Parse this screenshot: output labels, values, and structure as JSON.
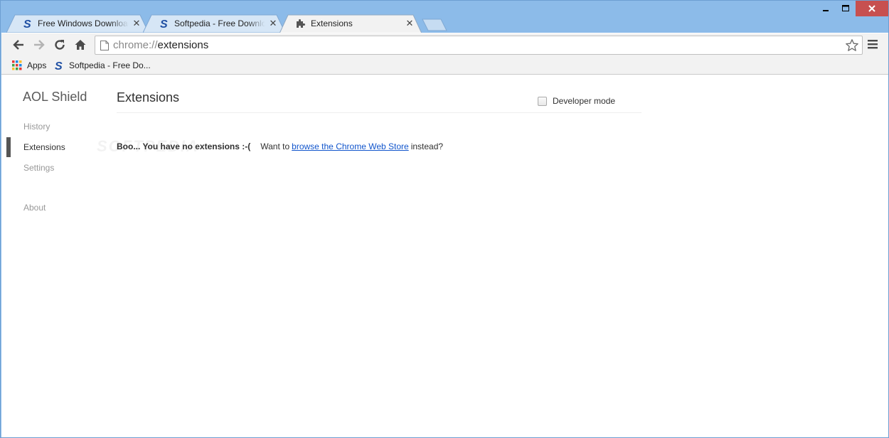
{
  "window": {
    "controls": {
      "minimize": "–",
      "maximize": "□",
      "close": "✕"
    }
  },
  "tabs": [
    {
      "title": "Free Windows Downloads",
      "favicon": "softpedia-s-icon",
      "active": false
    },
    {
      "title": "Softpedia - Free Downloads",
      "favicon": "softpedia-s-icon",
      "active": false
    },
    {
      "title": "Extensions",
      "favicon": "puzzle-piece-icon",
      "active": true
    }
  ],
  "toolbar": {
    "url_scheme": "chrome://",
    "url_path": "extensions"
  },
  "bookmarks": [
    {
      "label": "Apps",
      "icon": "apps-grid-icon"
    },
    {
      "label": "Softpedia - Free Do...",
      "icon": "softpedia-s-icon"
    }
  ],
  "sidebar": {
    "brand": "AOL Shield",
    "items": [
      {
        "label": "History",
        "active": false
      },
      {
        "label": "Extensions",
        "active": true
      },
      {
        "label": "Settings",
        "active": false
      },
      {
        "label": "About",
        "active": false
      }
    ]
  },
  "main": {
    "title": "Extensions",
    "developer_mode_label": "Developer mode",
    "developer_mode_checked": false,
    "empty_bold": "Boo... You have no extensions :-(",
    "empty_prefix": "Want to",
    "empty_link": "browse the Chrome Web Store",
    "empty_suffix": "instead?"
  },
  "watermark": "SOFTPEDIA",
  "colors": {
    "frame": "#8cbbe9",
    "close_button": "#c75050",
    "link": "#1155cc",
    "toolbar": "#f2f2f2",
    "softpedia_blue": "#1f4fa3"
  }
}
